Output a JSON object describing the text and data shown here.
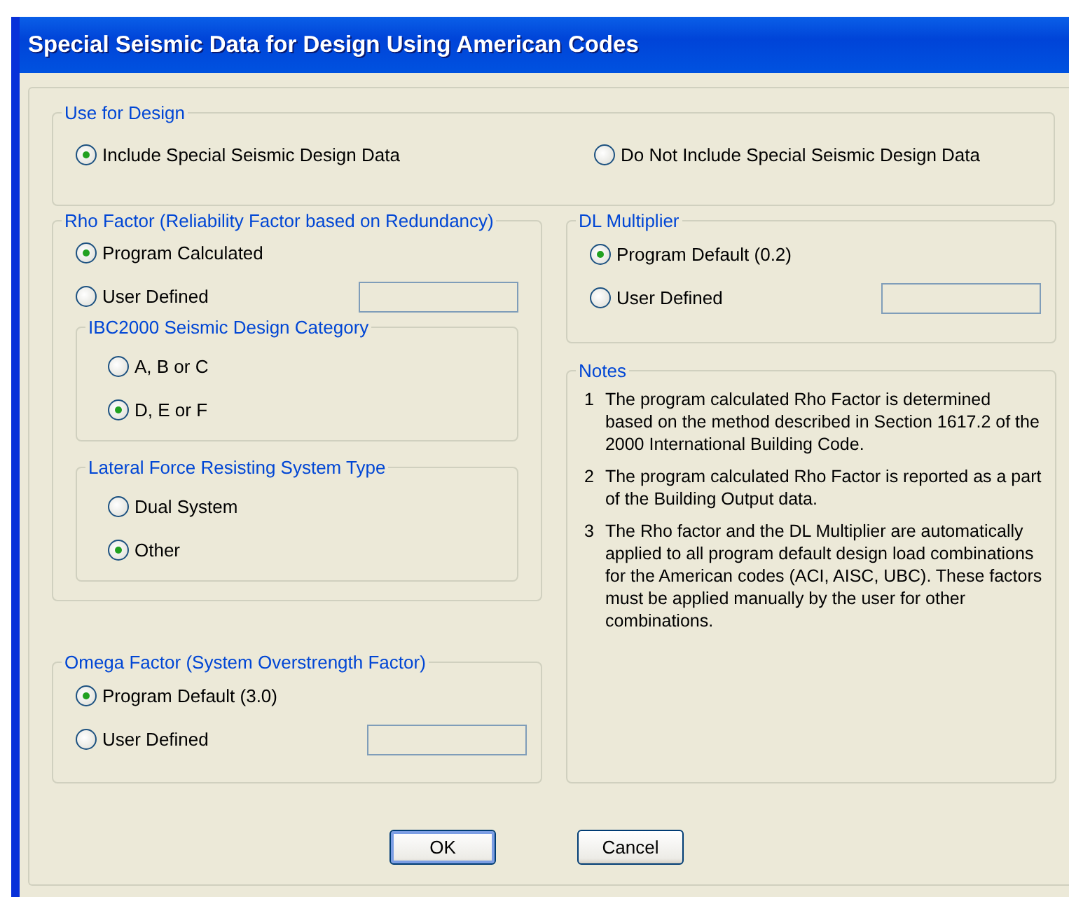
{
  "window": {
    "title": "Special Seismic Data for Design Using American Codes"
  },
  "use_for_design": {
    "legend": "Use for Design",
    "options": [
      {
        "label": "Include Special Seismic Design Data",
        "selected": true,
        "kind": "plain"
      },
      {
        "label": "Do Not Include Special Seismic Design Data",
        "selected": false,
        "kind": "plain"
      }
    ]
  },
  "rho_factor": {
    "legend": "Rho Factor (Reliability Factor based on Redundancy)",
    "options": [
      {
        "label": "Program Calculated",
        "selected": true,
        "kind": "plain"
      },
      {
        "label": "User Defined",
        "selected": false,
        "kind": "field"
      }
    ],
    "subgroups": [
      {
        "legend": "IBC2000 Seismic Design Category",
        "options": [
          {
            "label": "A, B or C",
            "selected": false,
            "kind": "plain"
          },
          {
            "label": "D, E or F",
            "selected": true,
            "kind": "plain"
          }
        ]
      },
      {
        "legend": "Lateral Force Resisting System Type",
        "options": [
          {
            "label": "Dual System",
            "selected": false,
            "kind": "plain"
          },
          {
            "label": "Other",
            "selected": true,
            "kind": "plain"
          }
        ]
      }
    ]
  },
  "omega_factor": {
    "legend": "Omega Factor (System Overstrength Factor)",
    "options": [
      {
        "label": "Program Default (3.0)",
        "selected": true,
        "kind": "plain"
      },
      {
        "label": "User Defined",
        "selected": false,
        "kind": "field"
      }
    ]
  },
  "dl_multiplier": {
    "legend": "DL Multiplier",
    "options": [
      {
        "label": "Program Default (0.2)",
        "selected": true,
        "kind": "plain"
      },
      {
        "label": "User Defined",
        "selected": false,
        "kind": "field"
      }
    ]
  },
  "notes": {
    "legend": "Notes",
    "items": [
      {
        "number": "1",
        "text": "The program calculated Rho Factor is determined based on the method described in Section 1617.2 of the 2000 International Building Code."
      },
      {
        "number": "2",
        "text": "The program calculated Rho Factor is reported as a part of the Building Output data."
      },
      {
        "number": "3",
        "text": "The Rho factor and the DL Multiplier are automatically applied to all program default design load combinations for the American codes (ACI, AISC, UBC).  These factors must be applied manually by the user for other combinations."
      }
    ]
  },
  "buttons": [
    {
      "label": "OK",
      "default": true
    },
    {
      "label": "Cancel",
      "default": false
    }
  ]
}
